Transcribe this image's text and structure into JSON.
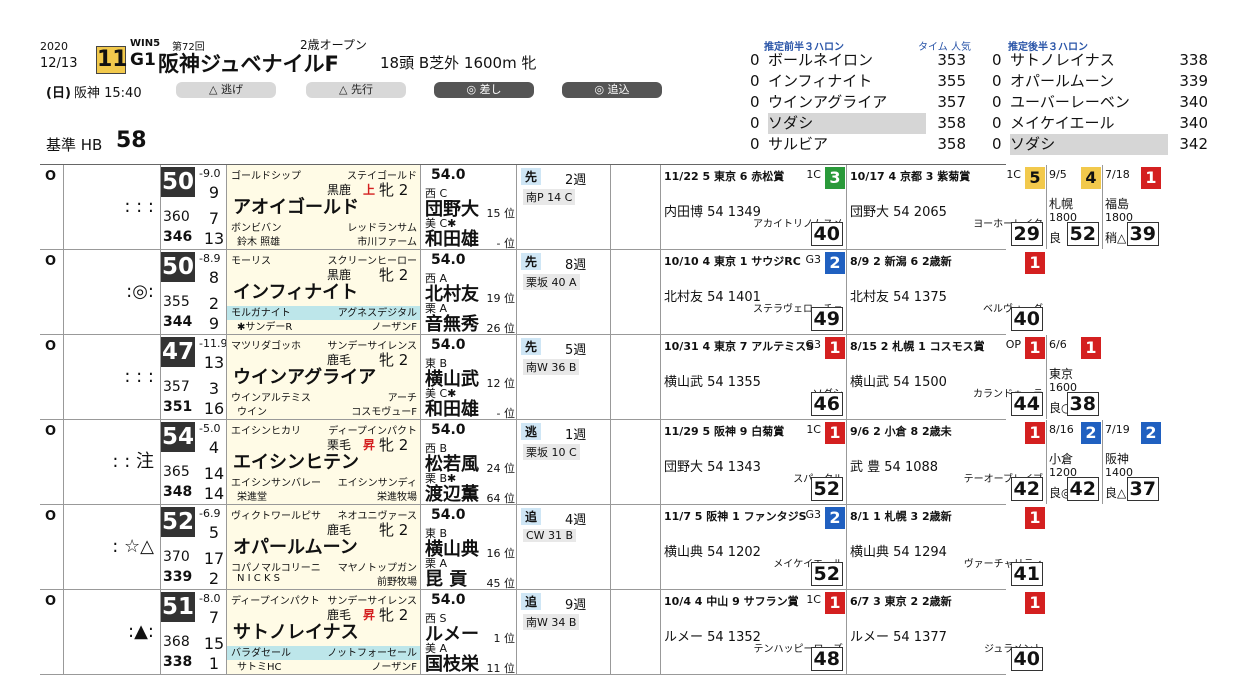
{
  "header": {
    "year": "2020",
    "date": "12/13",
    "weekday": "(日)",
    "venue_time": "阪神 15:40",
    "race_number": "11",
    "win5": "WIN5",
    "edition": "第72回",
    "grade": "G1",
    "race_name": "阪神ジュベナイルF",
    "category": "2歳オープン",
    "conditions": "18頭 B芝外 1600m 牝",
    "base": "基準 HB",
    "base_value": "58"
  },
  "filters": [
    "△  逃げ",
    "△  先行",
    "◎  差し",
    "◎  追込"
  ],
  "side_front": {
    "title": "推定前半３ハロン",
    "col": "タイム 人気",
    "rows": [
      {
        "z": "0",
        "name": "ボールネイロン",
        "time": "353",
        "hl": false
      },
      {
        "z": "0",
        "name": "インフィナイト",
        "time": "355",
        "hl": false
      },
      {
        "z": "0",
        "name": "ウインアグライア",
        "time": "357",
        "hl": false
      },
      {
        "z": "0",
        "name": "ソダシ",
        "time": "358",
        "hl": true
      },
      {
        "z": "0",
        "name": "サルビア",
        "time": "358",
        "hl": false
      }
    ]
  },
  "side_back": {
    "title": "推定後半３ハロン",
    "rows": [
      {
        "z": "0",
        "name": "サトノレイナス",
        "time": "338",
        "hl": false
      },
      {
        "z": "0",
        "name": "オパールムーン",
        "time": "339",
        "hl": false
      },
      {
        "z": "0",
        "name": "ユーバーレーベン",
        "time": "340",
        "hl": false
      },
      {
        "z": "0",
        "name": "メイケイエール",
        "time": "340",
        "hl": false
      },
      {
        "z": "0",
        "name": "ソダシ",
        "time": "342",
        "hl": true
      }
    ]
  },
  "horses": [
    {
      "mark": "O",
      "pred": ": : :",
      "index": "50",
      "diff": "-9.0",
      "n1": "9",
      "a": "360",
      "an": "7",
      "b": "346",
      "bn": "13",
      "sire": "ゴールドシップ",
      "sire_line": "ステイゴールド",
      "coat": "黒鹿",
      "flag": "上",
      "sex_age": "牝 2",
      "name": "アオイゴールド",
      "dam": "ボンビバン",
      "dam_sire": "レッドランサム",
      "owner": "鈴木 照雄",
      "breeder": "市川ファーム",
      "dam_cyan": false,
      "weight": "54.0",
      "stable": "西 C",
      "jockey": "団野大",
      "jpos": "15 位",
      "trainer_area": "美 C✱",
      "trainer": "和田雄",
      "tpos": "- 位",
      "style": "先",
      "interval": "2週",
      "course": "南P 14 C",
      "r1": {
        "date": "11/22 5 東京 6 赤松賞",
        "cls": "1C",
        "fin": "3",
        "col": "grn",
        "score": "40",
        "line": "内田博 54 1349",
        "extra": "アカイトリノムスメ"
      },
      "r2": {
        "date": "10/17 4 京都 3 紫菊賞",
        "cls": "1C",
        "fin": "5",
        "col": "yel",
        "score": "29",
        "line": "団野大 54 2065",
        "extra": "ヨーホーレイク"
      },
      "r3": {
        "date": "9/5",
        "fin": "4",
        "col": "yel",
        "place": "札幌",
        "dist": "1800",
        "score": "52",
        "cond": "良"
      },
      "r4": {
        "date": "7/18",
        "fin": "1",
        "col": "red",
        "place": "福島",
        "dist": "1800",
        "score": "39",
        "cond": "稍△"
      }
    },
    {
      "mark": "O",
      "pred": ":◎:",
      "index": "50",
      "diff": "-8.9",
      "n1": "8",
      "a": "355",
      "an": "2",
      "b": "344",
      "bn": "9",
      "sire": "モーリス",
      "sire_line": "スクリーンヒーロー",
      "coat": "黒鹿",
      "flag": "",
      "sex_age": "牝 2",
      "name": "インフィナイト",
      "dam": "モルガナイト",
      "dam_sire": "アグネスデジタル",
      "owner": "✱サンデーR",
      "breeder": "ノーザンF",
      "dam_cyan": true,
      "weight": "54.0",
      "stable": "西 A",
      "jockey": "北村友",
      "jpos": "19 位",
      "trainer_area": "栗 A",
      "trainer": "音無秀",
      "tpos": "26 位",
      "style": "先",
      "interval": "8週",
      "course": "栗坂 40 A",
      "r1": {
        "date": "10/10 4 東京 1 サウジRC",
        "cls": "G3",
        "fin": "2",
        "col": "blue",
        "score": "49",
        "line": "北村友 54 1401",
        "extra": "ステラヴェローチェ"
      },
      "r2": {
        "date": "8/9 2 新潟 6 2歳新",
        "cls": "",
        "fin": "1",
        "col": "red",
        "score": "40",
        "line": "北村友 54 1375",
        "extra": "ベルヴォーグ"
      },
      "r3": null,
      "r4": null
    },
    {
      "mark": "O",
      "pred": ": : :",
      "index": "47",
      "diff": "-11.9",
      "n1": "13",
      "a": "357",
      "an": "3",
      "b": "351",
      "bn": "16",
      "sire": "マツリダゴッホ",
      "sire_line": "サンデーサイレンス",
      "coat": "鹿毛",
      "flag": "",
      "sex_age": "牝 2",
      "name": "ウインアグライア",
      "dam": "ウインアルテミス",
      "dam_sire": "アーチ",
      "owner": "ウイン",
      "breeder": "コスモヴューF",
      "dam_cyan": false,
      "weight": "54.0",
      "stable": "東 B",
      "jockey": "横山武",
      "jpos": "12 位",
      "trainer_area": "美 C✱",
      "trainer": "和田雄",
      "tpos": "- 位",
      "style": "先",
      "interval": "5週",
      "course": "南W 36 B",
      "r1": {
        "date": "10/31 4 東京 7 アルテミスS",
        "cls": "G3",
        "fin": "1",
        "col": "red",
        "score": "46",
        "line": "横山武 54 1355",
        "extra": "ソダシ"
      },
      "r2": {
        "date": "8/15 2 札幌 1 コスモス賞",
        "cls": "OP",
        "fin": "1",
        "col": "red",
        "score": "44",
        "line": "横山武 54 1500",
        "extra": "カランドゥーラ"
      },
      "r3": {
        "date": "6/6",
        "fin": "1",
        "col": "red",
        "place": "東京",
        "dist": "1600",
        "score": "38",
        "cond": "良○"
      },
      "r4": null
    },
    {
      "mark": "O",
      "pred": ": : 注",
      "index": "54",
      "diff": "-5.0",
      "n1": "4",
      "a": "365",
      "an": "14",
      "b": "348",
      "bn": "14",
      "sire": "エイシンヒカリ",
      "sire_line": "ディープインパクト",
      "coat": "栗毛",
      "flag": "昇",
      "sex_age": "牝 2",
      "name": "エイシンヒテン",
      "dam": "エイシンサンバレー",
      "dam_sire": "エイシンサンディ",
      "owner": "栄進堂",
      "breeder": "栄進牧場",
      "dam_cyan": false,
      "weight": "54.0",
      "stable": "西 B",
      "jockey": "松若風",
      "jpos": "24 位",
      "trainer_area": "栗 B✱",
      "trainer": "渡辺薫",
      "tpos": "64 位",
      "style": "逃",
      "interval": "1週",
      "course": "栗坂 10 C",
      "r1": {
        "date": "11/29 5 阪神 9 白菊賞",
        "cls": "1C",
        "fin": "1",
        "col": "red",
        "score": "52",
        "line": "団野大 54 1343",
        "extra": "スパークル"
      },
      "r2": {
        "date": "9/6 2 小倉 8 2歳未",
        "cls": "",
        "fin": "1",
        "col": "red",
        "score": "42",
        "line": "武 豊 54 1088",
        "extra": "テーオーブレイブ"
      },
      "r3": {
        "date": "8/16",
        "fin": "2",
        "col": "blue",
        "place": "小倉",
        "dist": "1200",
        "score": "42",
        "cond": "良◎"
      },
      "r4": {
        "date": "7/19",
        "fin": "2",
        "col": "blue",
        "place": "阪神",
        "dist": "1400",
        "score": "37",
        "cond": "良△"
      }
    },
    {
      "mark": "O",
      "pred": ": ☆△",
      "index": "52",
      "diff": "-6.9",
      "n1": "5",
      "a": "370",
      "an": "17",
      "b": "339",
      "bn": "2",
      "sire": "ヴィクトワールピサ",
      "sire_line": "ネオユニヴァース",
      "coat": "鹿毛",
      "flag": "",
      "sex_age": "牝 2",
      "name": "オパールムーン",
      "dam": "コパノマルコリーニ",
      "dam_sire": "マヤノトップガン",
      "owner": "N I C K S",
      "breeder": "前野牧場",
      "dam_cyan": false,
      "weight": "54.0",
      "stable": "東 B",
      "jockey": "横山典",
      "jpos": "16 位",
      "trainer_area": "栗 A",
      "trainer": "昆 貢",
      "tpos": "45 位",
      "style": "追",
      "interval": "4週",
      "course": "CW 31 B",
      "r1": {
        "date": "11/7 5 阪神 1 ファンタジS",
        "cls": "G3",
        "fin": "2",
        "col": "blue",
        "score": "52",
        "line": "横山典 54 1202",
        "extra": "メイケイエール"
      },
      "r2": {
        "date": "8/1 1 札幌 3 2歳新",
        "cls": "",
        "fin": "1",
        "col": "red",
        "score": "41",
        "line": "横山典 54 1294",
        "extra": "ヴァーチャリティ"
      },
      "r3": null,
      "r4": null
    },
    {
      "mark": "O",
      "pred": ":▲:",
      "index": "51",
      "diff": "-8.0",
      "n1": "7",
      "a": "368",
      "an": "15",
      "b": "338",
      "bn": "1",
      "sire": "ディープインパクト",
      "sire_line": "サンデーサイレンス",
      "coat": "鹿毛",
      "flag": "昇",
      "sex_age": "牝 2",
      "name": "サトノレイナス",
      "dam": "バラダセール",
      "dam_sire": "ノットフォーセール",
      "owner": "サトミHC",
      "breeder": "ノーザンF",
      "dam_cyan": true,
      "weight": "54.0",
      "stable": "西 S",
      "jockey": "ルメー",
      "jpos": "1 位",
      "trainer_area": "美 A",
      "trainer": "国枝栄",
      "tpos": "11 位",
      "style": "追",
      "interval": "9週",
      "course": "南W 34 B",
      "r1": {
        "date": "10/4 4 中山 9 サフラン賞",
        "cls": "1C",
        "fin": "1",
        "col": "red",
        "score": "48",
        "line": "ルメー 54 1352",
        "extra": "テンハッピーローズ"
      },
      "r2": {
        "date": "6/7 3 東京 2 2歳新",
        "cls": "",
        "fin": "1",
        "col": "red",
        "score": "40",
        "line": "ルメー 54 1377",
        "extra": "ジュラメント"
      },
      "r3": null,
      "r4": null
    }
  ]
}
